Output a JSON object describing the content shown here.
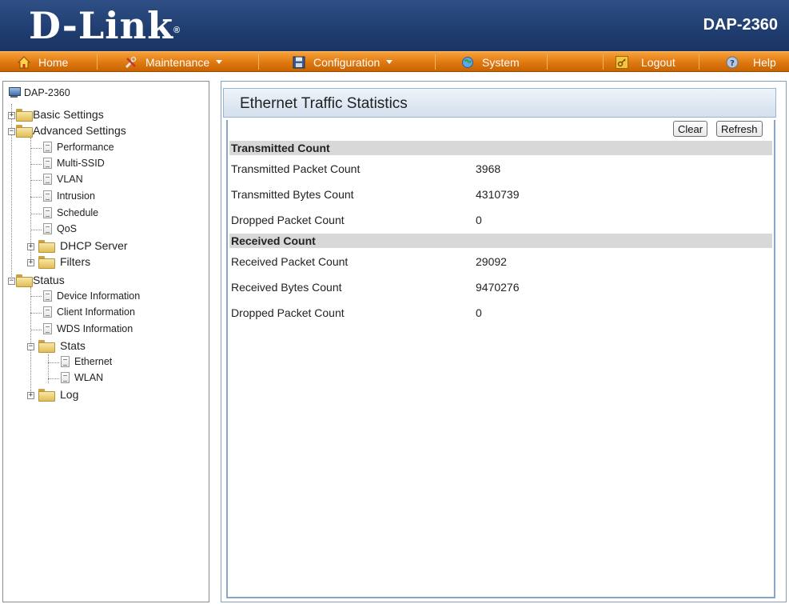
{
  "header": {
    "logo": "D-Link",
    "logo_reg": "®",
    "model": "DAP-2360"
  },
  "menu": {
    "home": "Home",
    "maintenance": "Maintenance",
    "configuration": "Configuration",
    "system": "System",
    "logout": "Logout",
    "help": "Help"
  },
  "tree": {
    "root": "DAP-2360",
    "basic_settings": "Basic Settings",
    "advanced_settings": "Advanced Settings",
    "performance": "Performance",
    "multi_ssid": "Multi-SSID",
    "vlan": "VLAN",
    "intrusion": "Intrusion",
    "schedule": "Schedule",
    "qos": "QoS",
    "dhcp_server": "DHCP Server",
    "filters": "Filters",
    "status": "Status",
    "device_information": "Device Information",
    "client_information": "Client Information",
    "wds_information": "WDS Information",
    "stats": "Stats",
    "ethernet": "Ethernet",
    "wlan": "WLAN",
    "log": "Log"
  },
  "panel": {
    "title": "Ethernet Traffic Statistics",
    "clear_label": "Clear",
    "refresh_label": "Refresh",
    "transmitted": {
      "header": "Transmitted Count",
      "rows": [
        {
          "label": "Transmitted Packet Count",
          "value": "3968"
        },
        {
          "label": "Transmitted Bytes Count",
          "value": "4310739"
        },
        {
          "label": "Dropped Packet Count",
          "value": "0"
        }
      ]
    },
    "received": {
      "header": "Received Count",
      "rows": [
        {
          "label": "Received Packet Count",
          "value": "29092"
        },
        {
          "label": "Received Bytes Count",
          "value": "9470276"
        },
        {
          "label": "Dropped Packet Count",
          "value": "0"
        }
      ]
    }
  },
  "colors": {
    "header_blue": "#1f3d6f",
    "menu_orange": "#e07810",
    "panel_border": "#8aa6c7",
    "section_gray": "#d8d8d8"
  }
}
